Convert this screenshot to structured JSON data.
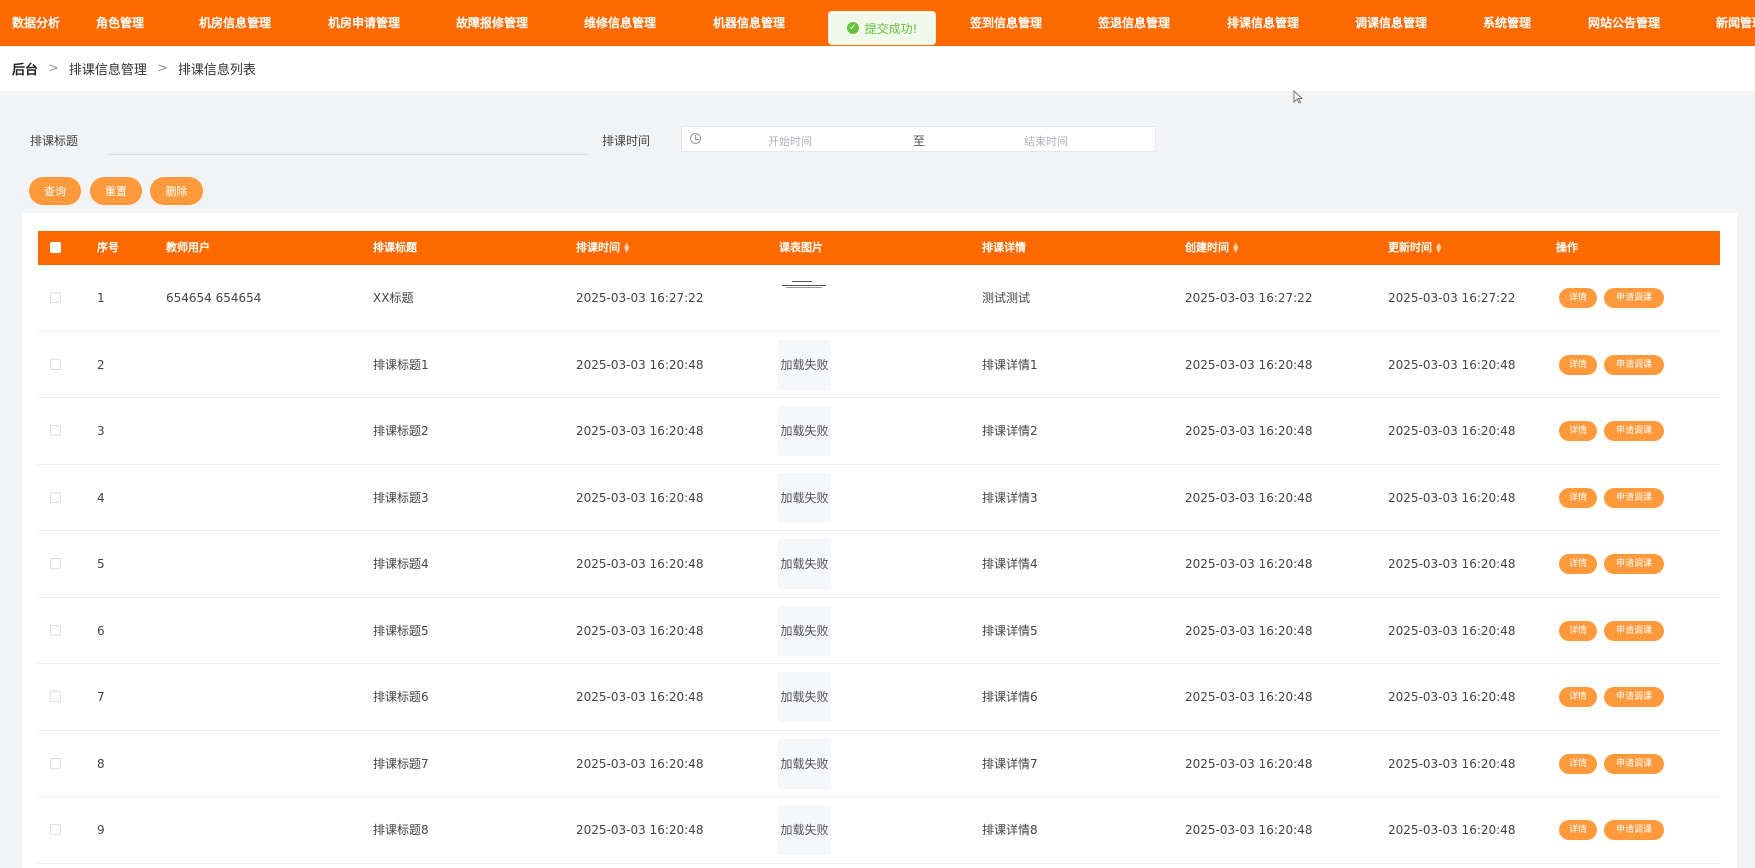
{
  "nav": {
    "items": [
      "数据分析",
      "角色管理",
      "机房信息管理",
      "机房申请管理",
      "故障报修管理",
      "维修信息管理",
      "机器信息管理",
      "签到信息管理",
      "签退信息管理",
      "排课信息管理",
      "调课信息管理",
      "系统管理",
      "网站公告管理",
      "新闻管理"
    ]
  },
  "toast": {
    "message": "提交成功!"
  },
  "breadcrumb": {
    "home": "后台",
    "section": "排课信息管理",
    "page": "排课信息列表"
  },
  "search": {
    "title_label": "排课标题",
    "title_value": "",
    "time_label": "排课时间",
    "start_placeholder": "开始时间",
    "range_separator": "至",
    "end_placeholder": "结束时间"
  },
  "buttons": {
    "query": "查询",
    "reset": "重置",
    "delete": "删除"
  },
  "table": {
    "headers": [
      "序号",
      "教师用户",
      "排课标题",
      "排课时间",
      "课表图片",
      "排课详情",
      "创建时间",
      "更新时间",
      "操作"
    ],
    "rows": [
      {
        "index": "1",
        "teacher": "654654 654654",
        "title": "XX标题",
        "time": "2025-03-03 16:27:22",
        "image": "",
        "detail": "测试测试",
        "created": "2025-03-03 16:27:22",
        "updated": "2025-03-03 16:27:22"
      },
      {
        "index": "2",
        "teacher": "",
        "title": "排课标题1",
        "time": "2025-03-03 16:20:48",
        "image": "加载失败",
        "detail": "排课详情1",
        "created": "2025-03-03 16:20:48",
        "updated": "2025-03-03 16:20:48"
      },
      {
        "index": "3",
        "teacher": "",
        "title": "排课标题2",
        "time": "2025-03-03 16:20:48",
        "image": "加载失败",
        "detail": "排课详情2",
        "created": "2025-03-03 16:20:48",
        "updated": "2025-03-03 16:20:48"
      },
      {
        "index": "4",
        "teacher": "",
        "title": "排课标题3",
        "time": "2025-03-03 16:20:48",
        "image": "加载失败",
        "detail": "排课详情3",
        "created": "2025-03-03 16:20:48",
        "updated": "2025-03-03 16:20:48"
      },
      {
        "index": "5",
        "teacher": "",
        "title": "排课标题4",
        "time": "2025-03-03 16:20:48",
        "image": "加载失败",
        "detail": "排课详情4",
        "created": "2025-03-03 16:20:48",
        "updated": "2025-03-03 16:20:48"
      },
      {
        "index": "6",
        "teacher": "",
        "title": "排课标题5",
        "time": "2025-03-03 16:20:48",
        "image": "加载失败",
        "detail": "排课详情5",
        "created": "2025-03-03 16:20:48",
        "updated": "2025-03-03 16:20:48"
      },
      {
        "index": "7",
        "teacher": "",
        "title": "排课标题6",
        "time": "2025-03-03 16:20:48",
        "image": "加载失败",
        "detail": "排课详情6",
        "created": "2025-03-03 16:20:48",
        "updated": "2025-03-03 16:20:48"
      },
      {
        "index": "8",
        "teacher": "",
        "title": "排课标题7",
        "time": "2025-03-03 16:20:48",
        "image": "加载失败",
        "detail": "排课详情7",
        "created": "2025-03-03 16:20:48",
        "updated": "2025-03-03 16:20:48"
      },
      {
        "index": "9",
        "teacher": "",
        "title": "排课标题8",
        "time": "2025-03-03 16:20:48",
        "image": "加载失败",
        "detail": "排课详情8",
        "created": "2025-03-03 16:20:48",
        "updated": "2025-03-03 16:20:48"
      }
    ],
    "row_actions": {
      "detail": "详情",
      "apply_adjust": "申请调课"
    }
  },
  "colors": {
    "brand": "#ff6a00",
    "button": "#ff9a3c",
    "success": "#67c23a"
  }
}
